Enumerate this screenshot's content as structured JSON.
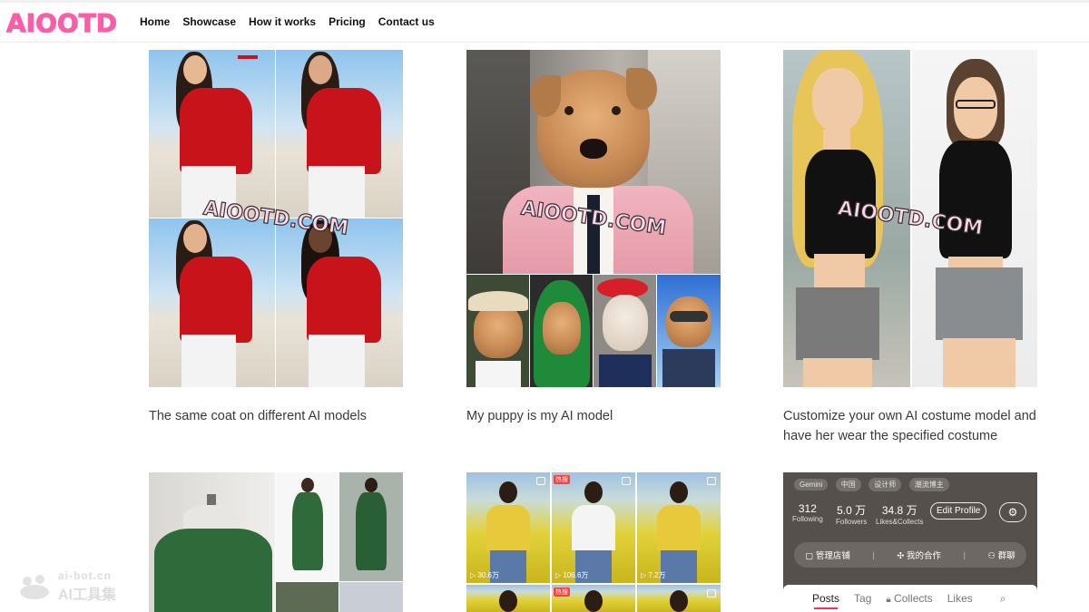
{
  "header": {
    "logo": "AIOOTD",
    "nav": [
      "Home",
      "Showcase",
      "How it works",
      "Pricing",
      "Contact us"
    ]
  },
  "watermark": "AIOOTD.COM",
  "cards": [
    {
      "caption": "The same coat on different AI models"
    },
    {
      "caption": "My puppy is my AI model"
    },
    {
      "caption": "Customize your own AI costume model and have her wear the specified costume"
    }
  ],
  "videos": [
    {
      "badge": "",
      "views": "30.6万"
    },
    {
      "badge": "",
      "views": "106.6万"
    },
    {
      "badge": "",
      "views": "7.2万"
    }
  ],
  "hot_badges": [
    "热搜",
    "热搜"
  ],
  "profile": {
    "chips": [
      "Gemini",
      "中国",
      "设计师",
      "潮流博主"
    ],
    "stats": [
      {
        "value": "312",
        "label": "Following"
      },
      {
        "value": "5.0 万",
        "label": "Followers"
      },
      {
        "value": "34.8 万",
        "label": "Likes&Collects"
      }
    ],
    "edit_label": "Edit Profile",
    "actions": [
      "管理店铺",
      "我的合作",
      "群聊"
    ],
    "tabs": [
      "Posts",
      "Tag",
      "Collects",
      "Likes"
    ]
  },
  "site_watermark": {
    "domain": "ai-bot.cn",
    "name": "AI工具集"
  },
  "colors": {
    "brand": "#ff5ca8",
    "active_tab": "#ff2e4d",
    "jacket_red": "#c8131b"
  }
}
